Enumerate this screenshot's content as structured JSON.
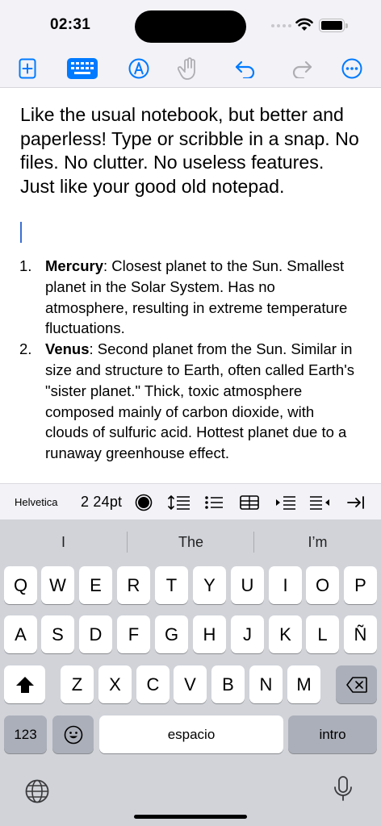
{
  "status": {
    "time": "02:31"
  },
  "toolbar": {
    "icons": [
      "add-page-icon",
      "keyboard-icon",
      "pen-markup-icon",
      "hand-icon",
      "undo-icon",
      "redo-icon",
      "more-icon"
    ]
  },
  "document": {
    "intro": "Like the usual notebook, but better and paperless! Type or scribble in a snap. No files. No clutter. No useless features. Just like your good old notepad.",
    "list": [
      {
        "num": "1.",
        "term": "Mercury",
        "text": ": Closest planet to the Sun. Smallest planet in the Solar System. Has no atmosphere, resulting in extreme temperature fluctuations."
      },
      {
        "num": "2.",
        "term": "Venus",
        "text": ": Second planet from the Sun. Similar in size and structure to Earth, often called Earth's \"sister planet.\" Thick, toxic atmosphere composed mainly of carbon dioxide, with clouds of sulfuric acid. Hottest planet due to a runaway greenhouse effect."
      }
    ]
  },
  "format_bar": {
    "font": "Helvetica",
    "size": "2 24pt",
    "accent": "#007aff"
  },
  "keyboard": {
    "suggestions": [
      "I",
      "The",
      "I’m"
    ],
    "row1": [
      "Q",
      "W",
      "E",
      "R",
      "T",
      "Y",
      "U",
      "I",
      "O",
      "P"
    ],
    "row2": [
      "A",
      "S",
      "D",
      "F",
      "G",
      "H",
      "J",
      "K",
      "L",
      "Ñ"
    ],
    "row3": [
      "Z",
      "X",
      "C",
      "V",
      "B",
      "N",
      "M"
    ],
    "numbers_key": "123",
    "space_key": "espacio",
    "return_key": "intro"
  }
}
